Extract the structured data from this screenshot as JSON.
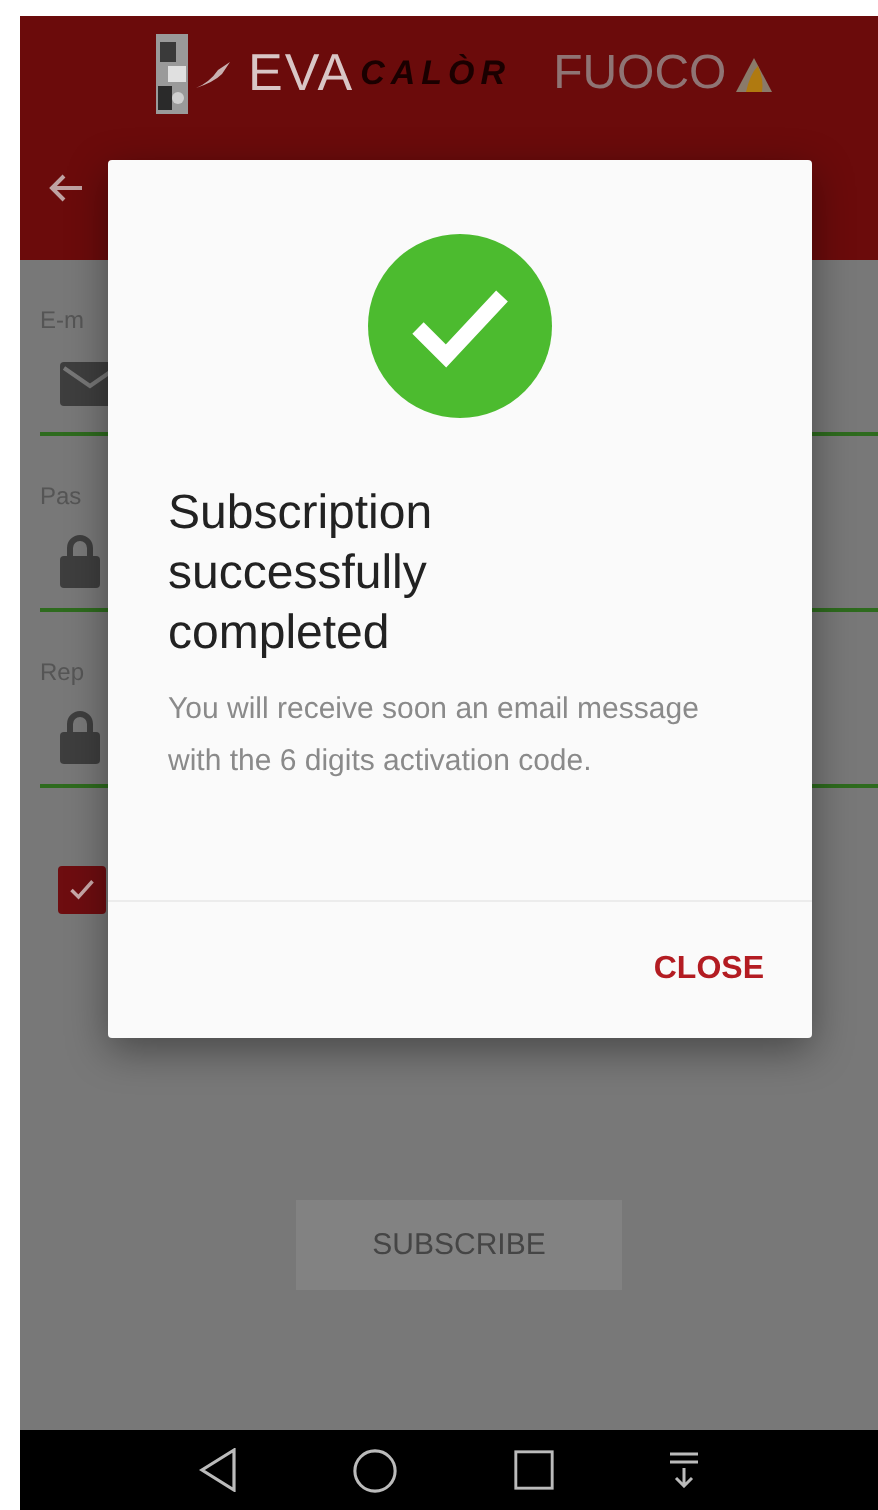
{
  "header": {
    "logo": [
      "EVA",
      "CALÒR",
      "FUOCO"
    ]
  },
  "form": {
    "fields": [
      {
        "label": "E-m",
        "kind": "mail"
      },
      {
        "label": "Pas",
        "kind": "lock"
      },
      {
        "label": "Rep",
        "kind": "lock"
      }
    ],
    "checkbox": {
      "checked": true
    },
    "subscribe_button": "SUBSCRIBE"
  },
  "dialog": {
    "title": "Subscription successfully completed",
    "message": "You will receive soon an email message with the 6 digits activation code.",
    "button": "CLOSE"
  }
}
